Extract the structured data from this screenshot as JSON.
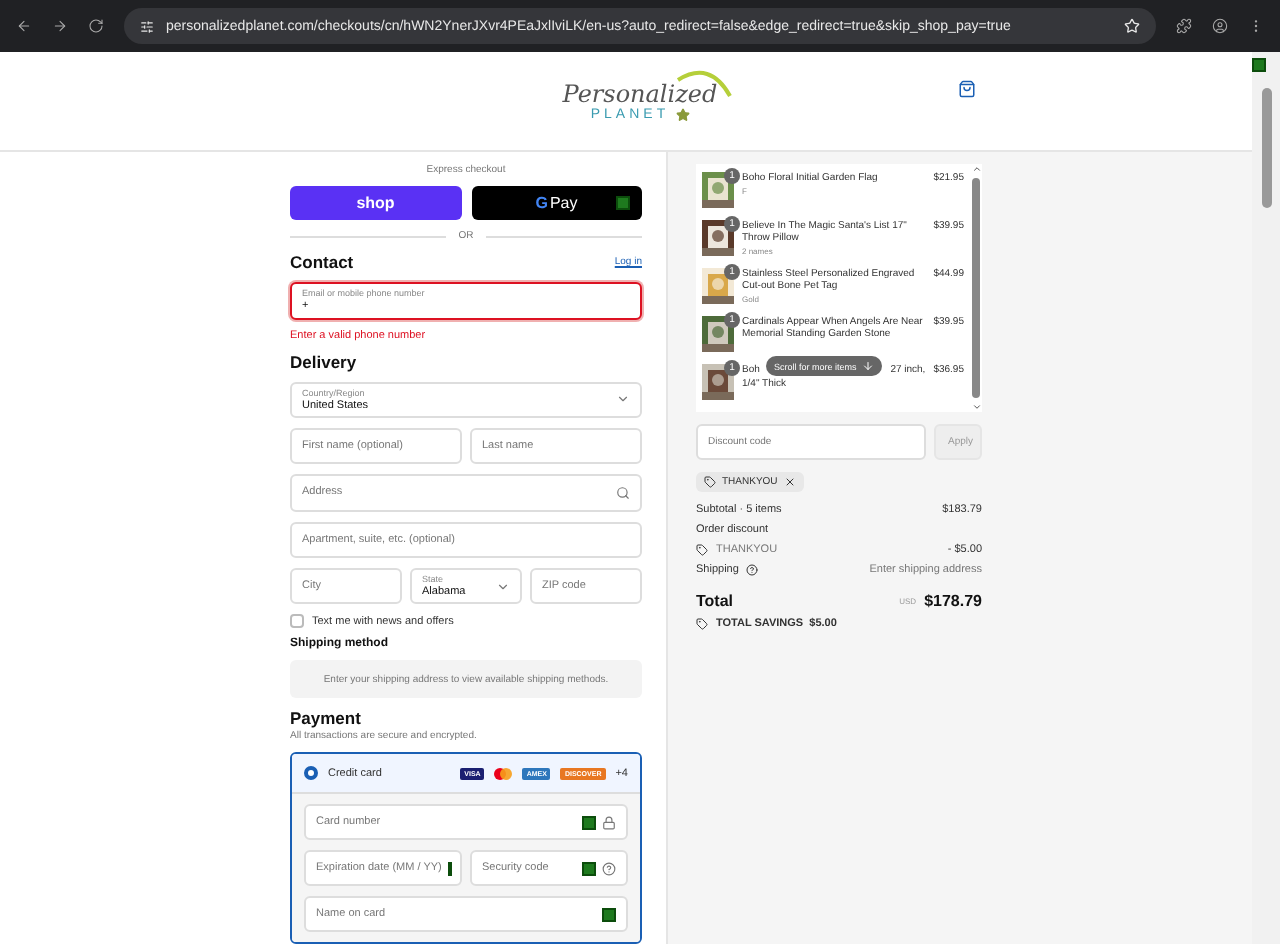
{
  "browser": {
    "url": "personalizedplanet.com/checkouts/cn/hWN2YnerJXvr4PEaJxlIviLK/en-us?auto_redirect=false&edge_redirect=true&skip_shop_pay=true"
  },
  "header": {
    "logo_top": "Personalized",
    "logo_bottom": "PLANET"
  },
  "express": {
    "label": "Express checkout",
    "shop": "shop",
    "gpay_g": "G",
    "gpay": "Pay",
    "divider": "OR"
  },
  "contact": {
    "heading": "Contact",
    "login": "Log in",
    "field_label": "Email or mobile phone number",
    "value": "+",
    "error": "Enter a valid phone number",
    "invalid": true
  },
  "delivery": {
    "heading": "Delivery",
    "country_label": "Country/Region",
    "country": "United States",
    "first_name": "First name (optional)",
    "last_name": "Last name",
    "address": "Address",
    "apartment": "Apartment, suite, etc. (optional)",
    "city": "City",
    "state_label": "State",
    "state": "Alabama",
    "zip": "ZIP code",
    "sms": {
      "label": "Text me with news and offers",
      "checked": false
    }
  },
  "shipping": {
    "heading": "Shipping method",
    "note": "Enter your shipping address to view available shipping methods."
  },
  "payment": {
    "heading": "Payment",
    "note": "All transactions are secure and encrypted.",
    "method": {
      "label": "Credit card",
      "selected": true,
      "brands": [
        "VISA",
        "AMEX",
        "DISCOVER"
      ],
      "more": "+4"
    },
    "card_number": "Card number",
    "expiry": "Expiration date (MM / YY)",
    "security": "Security code",
    "name": "Name on card"
  },
  "items": [
    {
      "name": "Boho Floral Initial Garden Flag",
      "variant": "F",
      "price": "$21.95",
      "qty": "1"
    },
    {
      "name": "Believe In The Magic Santa's List 17\" Throw Pillow",
      "variant": "2 names",
      "price": "$39.95",
      "qty": "1"
    },
    {
      "name": "Stainless Steel Personalized Engraved Cut-out Bone Pet Tag",
      "variant": "Gold",
      "price": "$44.99",
      "qty": "1"
    },
    {
      "name": "Cardinals Appear When Angels Are Near Memorial Standing Garden Stone",
      "price": "$39.95",
      "qty": "1"
    },
    {
      "name": "Boh",
      "name_tail": "27 inch,",
      "name_line2": "1/4\" Thick",
      "price": "$36.95",
      "qty": "1"
    }
  ],
  "scroll_hint": "Scroll for more items",
  "discount": {
    "placeholder": "Discount code",
    "apply": "Apply",
    "tag": "THANKYOU"
  },
  "summary": {
    "subtotal_label": "Subtotal · 5 items",
    "subtotal": "$183.79",
    "discount_label": "Order discount",
    "discount_code": "THANKYOU",
    "discount": "- $5.00",
    "shipping_label": "Shipping",
    "shipping": "Enter shipping address",
    "total_label": "Total",
    "currency": "USD",
    "total": "$178.79",
    "savings": "TOTAL SAVINGS  $5.00"
  }
}
